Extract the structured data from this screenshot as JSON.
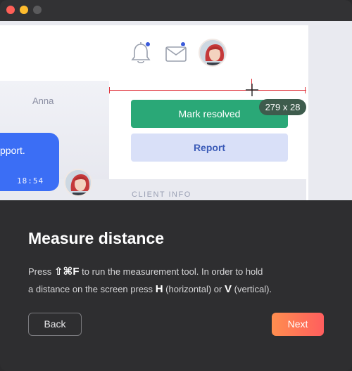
{
  "window": {
    "traffic_lights": [
      "close",
      "minimize",
      "zoom"
    ]
  },
  "preview": {
    "chat": {
      "sender_name": "Anna",
      "message_fragment": "pport.",
      "timestamp": "18:54"
    },
    "actions": {
      "resolve_label": "Mark resolved",
      "report_label": "Report"
    },
    "section_label": "CLIENT INFO",
    "measurement": {
      "readout": "279 x 28"
    },
    "colors": {
      "accent_green": "#2aa877",
      "accent_blue": "#3b6ef5",
      "measure_red": "#e0323a"
    }
  },
  "info": {
    "title": "Measure distance",
    "line1_prefix": "Press",
    "shortcut": "⇧⌘F",
    "line1_suffix": "to run the measurement tool. In order to hold",
    "line2_prefix": "a distance on the screen press",
    "key_h": "H",
    "line2_mid": "(horizontal) or",
    "key_v": "V",
    "line2_suffix": "(vertical).",
    "back_label": "Back",
    "next_label": "Next"
  }
}
